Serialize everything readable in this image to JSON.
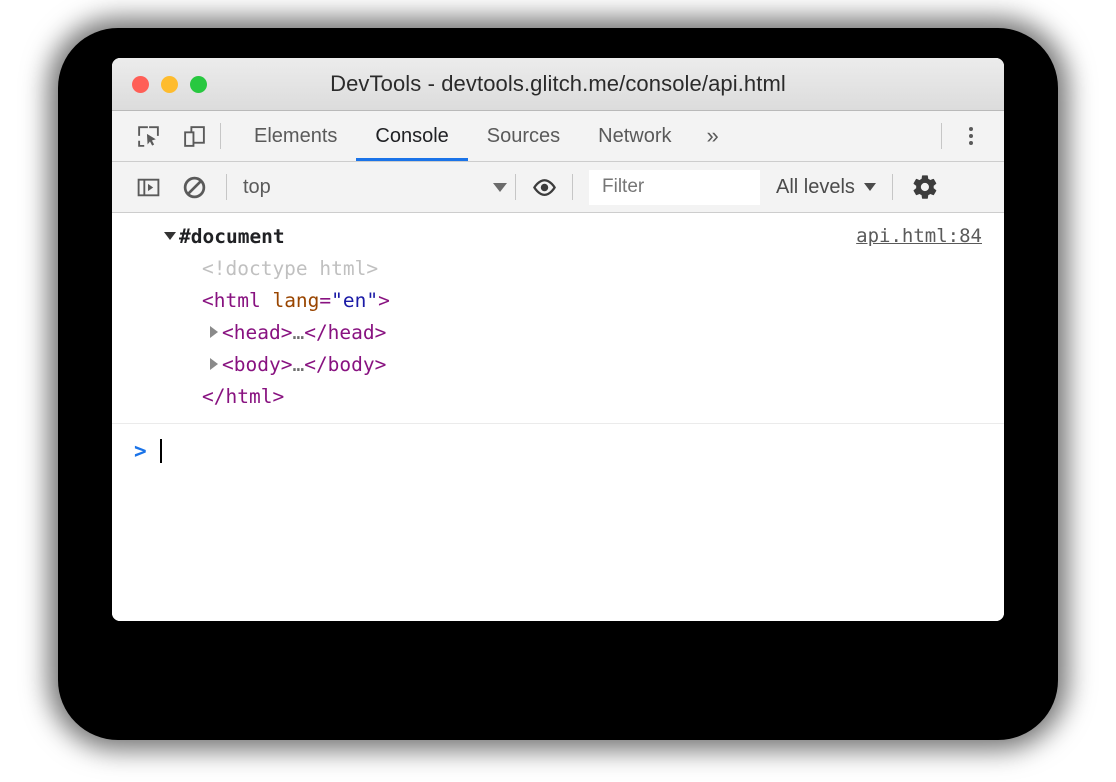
{
  "window": {
    "title": "DevTools - devtools.glitch.me/console/api.html",
    "traffic_lights": [
      {
        "name": "close",
        "color": "#ff5f57"
      },
      {
        "name": "minimize",
        "color": "#febc2e"
      },
      {
        "name": "zoom",
        "color": "#28c840"
      }
    ]
  },
  "toolbar": {
    "inspect_icon": "inspect-element-icon",
    "device_icon": "device-toolbar-icon",
    "overflow_label": "»",
    "menu_icon": "more-vertical-icon",
    "tabs": [
      {
        "label": "Elements",
        "active": false
      },
      {
        "label": "Console",
        "active": true
      },
      {
        "label": "Sources",
        "active": false
      },
      {
        "label": "Network",
        "active": false
      }
    ],
    "active_tab_color": "#1a73e8"
  },
  "console_toolbar": {
    "sidebar_icon": "console-sidebar-icon",
    "clear_icon": "clear-console-icon",
    "context": "top",
    "eye_icon": "live-expression-eye-icon",
    "filter_placeholder": "Filter",
    "filter_value": "",
    "levels": "All levels",
    "settings_icon": "gear-icon"
  },
  "console": {
    "source_link": "api.html:84",
    "prompt_symbol": ">",
    "prompt_value": "",
    "dom": {
      "root_label": "#document",
      "doctype": "<!doctype html>",
      "html_open_tag": "<html ",
      "html_attr_name": "lang",
      "html_attr_eq": "=",
      "html_attr_value": "\"en\"",
      "html_open_close": ">",
      "head_line": "<head>",
      "head_ellipsis": "…",
      "head_close": "</head>",
      "body_line": "<body>",
      "body_ellipsis": "…",
      "body_close": "</body>",
      "html_close": "</html>"
    }
  },
  "colors": {
    "accent": "#1a73e8",
    "tag": "#881280",
    "attr_name": "#994500",
    "attr_value": "#1a1aa6",
    "comment": "#c0c0c0"
  }
}
